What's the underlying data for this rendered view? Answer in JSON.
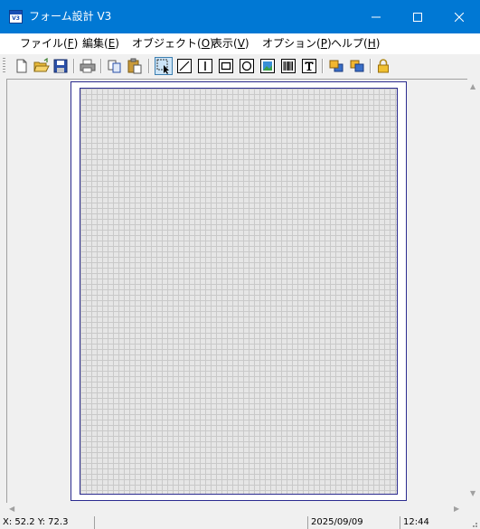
{
  "window": {
    "title": "フォーム設計 V3",
    "icon_label": "V3",
    "controls": [
      "minimize-icon",
      "maximize-icon",
      "close-icon"
    ],
    "accent_color": "#0078d4"
  },
  "menu": {
    "items": [
      {
        "label": "ファイル(",
        "accel": "F",
        "close": ")"
      },
      {
        "label": "編集(",
        "accel": "E",
        "close": ")"
      },
      {
        "label": "オブジェクト(",
        "accel": "O",
        "close": ")"
      },
      {
        "label": "表示(",
        "accel": "V",
        "close": ")"
      },
      {
        "label": "オプション(",
        "accel": "P",
        "close": ")"
      },
      {
        "label": "ヘルプ(",
        "accel": "H",
        "close": ")"
      }
    ]
  },
  "toolbar": {
    "buttons": [
      "new-file-icon",
      "open-folder-icon",
      "save-disk-icon",
      "print-icon",
      "copy-icon",
      "paste-icon",
      "select-pointer-icon",
      "line-tool-icon",
      "vertical-line-tool-icon",
      "rectangle-tool-icon",
      "ellipse-tool-icon",
      "image-tool-icon",
      "barcode-tool-icon",
      "text-tool-icon",
      "bring-to-front-icon",
      "send-to-back-icon",
      "lock-icon"
    ],
    "active_tool": "select-pointer-icon"
  },
  "status": {
    "coords": "X: 52.2 Y: 72.3",
    "date": "2025/09/09",
    "time": "12:44"
  }
}
